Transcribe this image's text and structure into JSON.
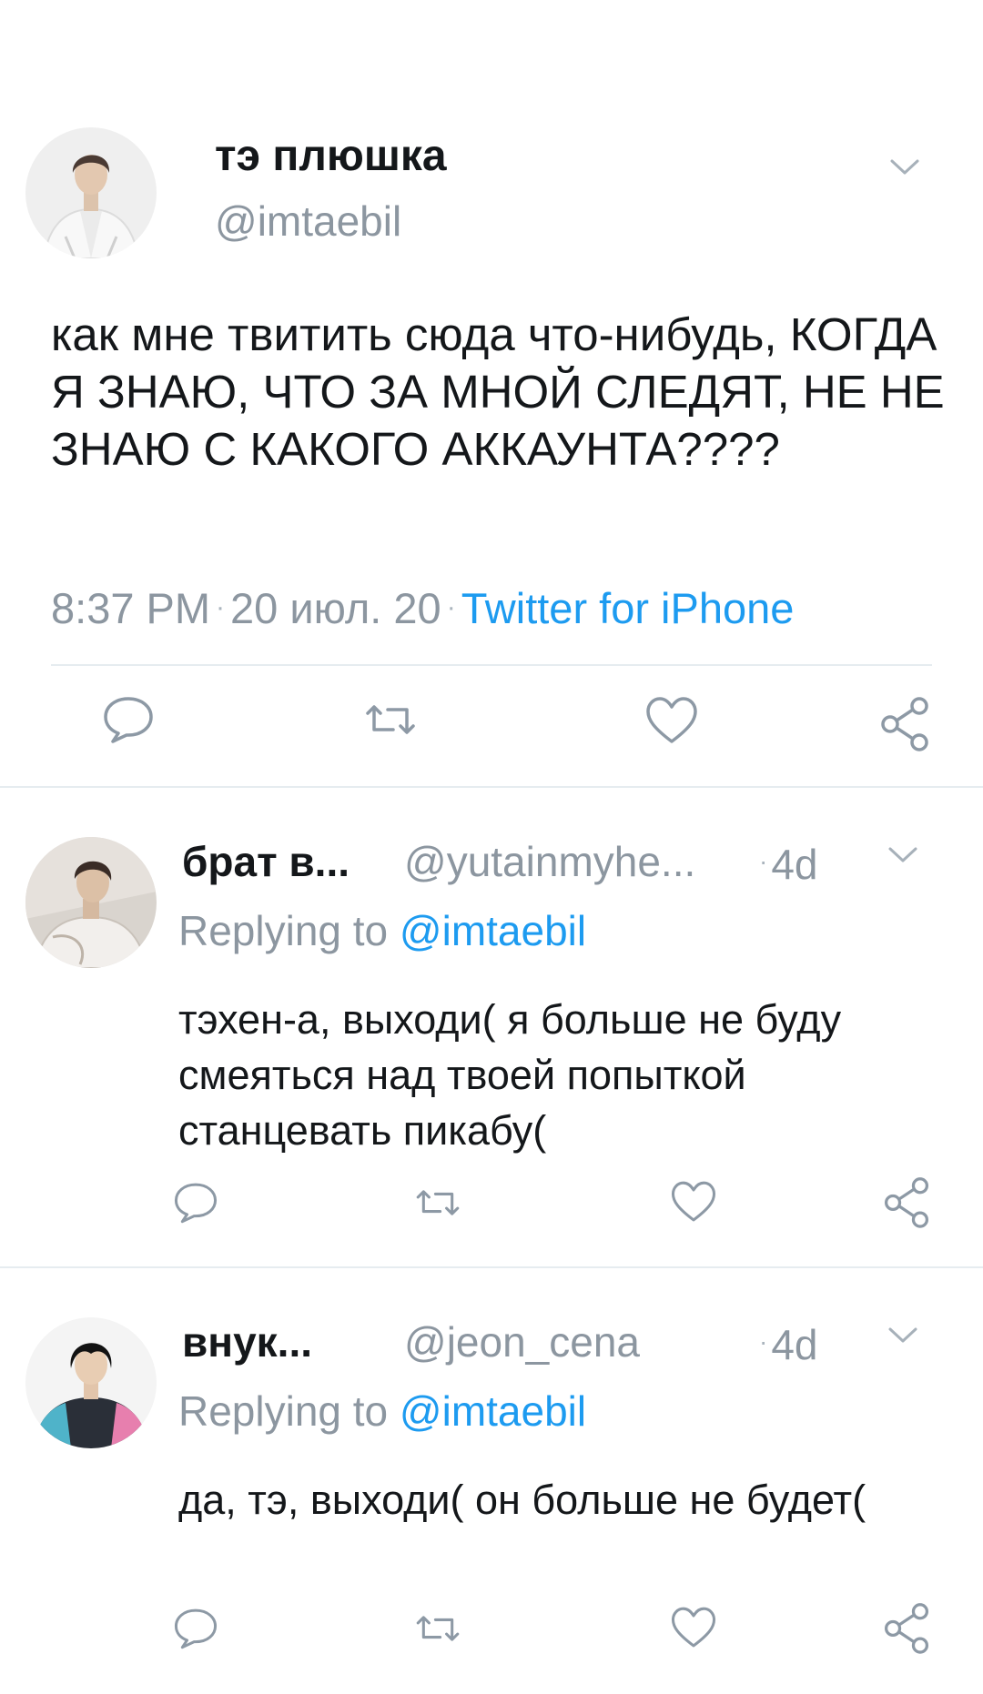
{
  "main_tweet": {
    "display_name": "тэ плюшка",
    "handle": "@imtaebil",
    "text": "как мне твитить сюда что-нибудь, КОГДА Я ЗНАЮ, ЧТО ЗА МНОЙ СЛЕДЯТ, НЕ НЕ ЗНАЮ С КАКОГО АККАУНТА????",
    "time": "8:37 PM",
    "date": "20 июл. 20",
    "client": "Twitter for iPhone"
  },
  "replies": [
    {
      "display_name": "брат в...",
      "handle": "@yutainmyhe...",
      "time": "4d",
      "replying_prefix": "Replying to",
      "replying_to": "@imtaebil",
      "text": "тэхен-а, выходи( я больше не буду смеяться над твоей попыткой станцевать пикабу("
    },
    {
      "display_name": "внук...",
      "handle": "@jeon_cena",
      "time": "4d",
      "replying_prefix": "Replying to",
      "replying_to": "@imtaebil",
      "text": "да, тэ, выходи( он больше не будет("
    }
  ],
  "icons": {
    "reply": "reply-icon",
    "retweet": "retweet-icon",
    "like": "like-icon",
    "share": "share-icon",
    "more": "chevron-down-icon"
  },
  "colors": {
    "link": "#1d9bf0",
    "secondary_text": "#8c96a0",
    "icon_gray": "#8d99a5",
    "divider": "#e6ecf0",
    "primary_text": "#14171a"
  }
}
